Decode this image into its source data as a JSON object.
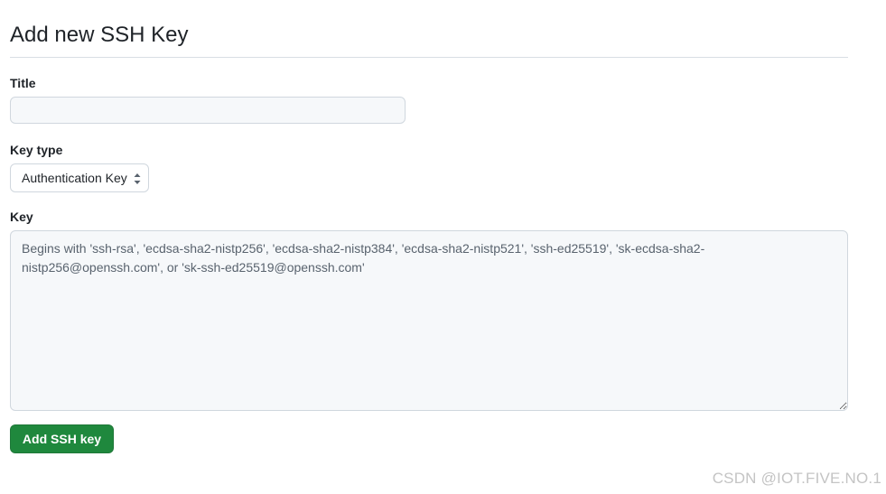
{
  "page": {
    "heading": "Add new SSH Key"
  },
  "form": {
    "title_label": "Title",
    "title_value": "",
    "title_placeholder": "",
    "key_type_label": "Key type",
    "key_type_selected": "Authentication Key",
    "key_label": "Key",
    "key_value": "",
    "key_placeholder": "Begins with 'ssh-rsa', 'ecdsa-sha2-nistp256', 'ecdsa-sha2-nistp384', 'ecdsa-sha2-nistp521', 'ssh-ed25519', 'sk-ecdsa-sha2-nistp256@openssh.com', or 'sk-ssh-ed25519@openssh.com'",
    "submit_label": "Add SSH key"
  },
  "watermark": {
    "text": "CSDN @IOT.FIVE.NO.1"
  },
  "colors": {
    "primary_button": "#1f883d",
    "input_background": "#f6f8fa",
    "border": "#d0d7de"
  },
  "icons": {
    "select_arrows": "select-arrows-icon"
  }
}
